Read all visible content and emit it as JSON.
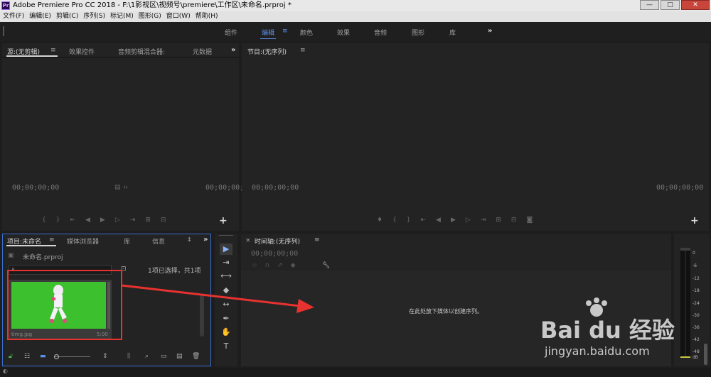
{
  "window": {
    "logo": "Pr",
    "title": "Adobe Premiere Pro CC 2018 - F:\\1影视区\\视频号\\premiere\\工作区\\未命名.prproj *",
    "buttons": {
      "minimize": "—",
      "maximize": "□",
      "close": "✕"
    }
  },
  "menu": [
    "文件(F)",
    "编辑(E)",
    "剪辑(C)",
    "序列(S)",
    "标记(M)",
    "图形(G)",
    "窗口(W)",
    "帮助(H)"
  ],
  "workspaces": {
    "items": [
      "组件",
      "编辑",
      "颜色",
      "效果",
      "音频",
      "图形",
      "库"
    ],
    "active": "编辑",
    "more": "»"
  },
  "source_panel": {
    "tabs": [
      "源:(无剪辑)",
      "效果控件",
      "音频剪辑混合器:",
      "元数据"
    ],
    "more": "»",
    "timecode_left": "00;00;00;00",
    "timecode_right": "00;00;00;0",
    "add": "+"
  },
  "program_panel": {
    "title": "节目:(无序列)",
    "timecode_left": "00;00;00;00",
    "timecode_right": "00;00;00;00",
    "add": "+"
  },
  "project_panel": {
    "tabs": [
      "项目:未命名",
      "媒体浏览器",
      "库",
      "信息",
      "‡"
    ],
    "more": "»",
    "file": "未命名.prproj",
    "selection": "1项已选择，共1项",
    "clip": {
      "name": "timg.jpg",
      "duration": "5:00"
    }
  },
  "tools": [
    "▶",
    "⇥",
    "⟷",
    "◆",
    "↔",
    "✒",
    "✋",
    "T"
  ],
  "timeline_panel": {
    "close": "×",
    "title": "时间轴:(无序列)",
    "timecode": "00;00;00;00",
    "empty_hint": "在此处放下媒体以创建序列。"
  },
  "audio_meter": {
    "scale": [
      "0",
      "-6",
      "-12",
      "-18",
      "-24",
      "-30",
      "-36",
      "-42",
      "-48",
      "dB"
    ]
  },
  "watermark": {
    "brand": "Bai du 经验",
    "url": "jingyan.baidu.com"
  },
  "colors": {
    "accent": "#5c8fe6",
    "annotation": "#e8322f",
    "clip_green": "#3cc02e"
  }
}
